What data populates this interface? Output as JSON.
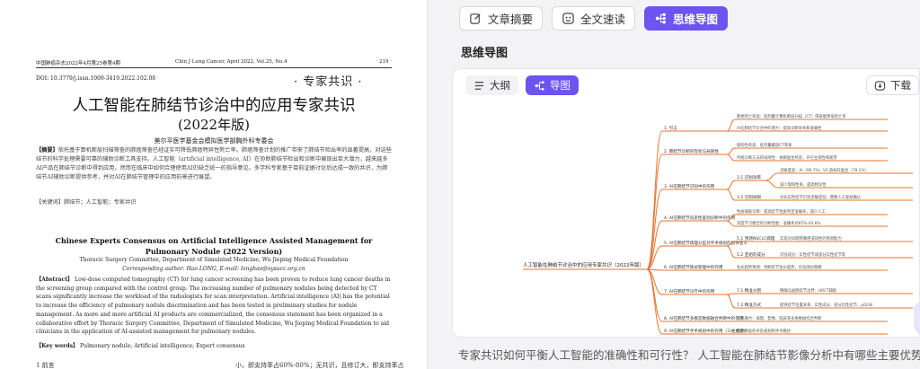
{
  "document": {
    "header_left": "中国肺癌杂志2022年4月第25卷第4期",
    "header_center": "Chin J Lung Cancer, April 2022, Vol.25, No.4",
    "header_right": "· 219 ·",
    "doi": "DOI: 10.3779/j.issn.1009-3419.2022.102.08",
    "stamp": "· 专家共识 ·",
    "title": "人工智能在肺结节诊治中的应用专家共识",
    "title_edition": "(2022年版)",
    "organization": "美尔平医学基金会模拟医学部胸外科专委会",
    "cn_abstract_label": "【摘要】",
    "cn_abstract": "依托基于算机断层扫描筛查的肺癌筛查已经证实可降低肺癌特异性死亡率。肺癌筛查计划的推广带来了肺结节检出率的显著提高，对这些结节的科学处理需要可靠的辅助诊断工具支持。人工智能（artificial intelligence, AI）在协助肺结节检出和诊断中展现出巨大潜力，越来越多AI产品在肺结节诊断中得到应用，然而在临床中如何合理使用AI仍缺乏统一的指导意见。多学科专家基于目前证据讨论后达成一致的共识，为肺结节AI辅助诊断提供参考，并对AI在肺结节管理中的应用前景进行展望。",
    "cn_keywords_label": "【关键词】",
    "cn_keywords": "肺结节；人工智能；专家共识",
    "en_title": "Chinese Experts Consensus on Artificial Intelligence Assisted Management for Pulmonary Nodule (2022 Version)",
    "en_affiliation": "Thoracic Surgery Committee, Department of Simulated Medicine, Wu Jieping Medical Foundation",
    "en_corresponding": "Corresponding author: Hao LONG, E-mail: longhao@sysucc.org.cn",
    "en_abstract_label": "【Abstract】",
    "en_abstract": "Low-dose computed tomography (CT) for lung cancer screening has been proven to reduce lung cancer deaths in the screening group compared with the control group. The increasing number of pulmonary nodules being detected by CT scans significantly increase the workload of the radiologists for scan interpretation. Artificial intelligence (AI) has the potential to increase the efficiency of pulmonary nodule discrimination and has been tested in preliminary studies for nodule management. As more and more artificial AI products are commercialized, the consensus statement has been organized in a collaborative effort by Thoracic Surgery Committee, Department of Simulated Medicine, Wu Jieping Medical Foundation to aid clinicians in the application of AI-assisted management for pulmonary nodules.",
    "en_keywords_label": "【Key words】",
    "en_keywords": "Pulmonary nodule; Artificial intelligence; Expert consensus",
    "footer_left": "1 前言",
    "footer_right": "小，即支持率占60%-80%；无共识，且修订大，即支持率占"
  },
  "panel": {
    "tabs": [
      {
        "label": "文章摘要",
        "icon": "edit-icon"
      },
      {
        "label": "全文速读",
        "icon": "reader-icon"
      },
      {
        "label": "思维导图",
        "icon": "mindmap-icon"
      }
    ],
    "section_title": "思维导图",
    "view_options": [
      {
        "label": "大纲",
        "icon": "outline-icon"
      },
      {
        "label": "导图",
        "icon": "mindmap-icon"
      }
    ],
    "download_label": "下载",
    "download2_label": "下",
    "question": "专家共识如何平衡人工智能的准确性和可行性？ 人工智能在肺结节影像分析中有哪些主要优势？",
    "accent_color": "#6b54ef",
    "branch_color": "#e8732e"
  },
  "mindmap": {
    "root": "人工智能在肺结节诊治中的应用专家共识（2022年版）",
    "branches": [
      {
        "label": "1. 引言",
        "children": [
          {
            "label": "肺癌死亡率高：低剂量计算机断层扫描（CT）筛查能降低死亡率"
          },
          {
            "label": "AI在肺结节诊治中的潜力：提高诊断效率和准确性"
          }
        ]
      },
      {
        "label": "2. 肺结节诊断的现状与局限性",
        "children": [
          {
            "label": "假阳性率高：低剂量螺旋CT筛查"
          },
          {
            "label": "传统诊断方法的局限性：依赖医生经验，存在主观性和疲劳"
          }
        ]
      },
      {
        "label": "3. AI在肺结节识别中的作用",
        "children": [
          {
            "label": "3.1 识别效率",
            "children": [
              {
                "label": "灵敏度高：AI（96.7%）VS 放射科医生（78.1%）"
              },
              {
                "label": "减少假阳性率，提高特异性"
              }
            ]
          },
          {
            "label": "3.2 识别局限",
            "children": [
              {
                "label": "对非实性结节识别灵敏度低：需要人工复核确认"
              }
            ]
          }
        ]
      },
      {
        "label": "4. AI在肺结节良恶性鉴别诊断中的作用",
        "children": [
          {
            "label": "性质辅助诊断：提高结节性质判定准确率，减少人工"
          },
          {
            "label": "深度学习模型的诊断性能：准确率达85%-93.6%"
          }
        ]
      },
      {
        "label": "5. AI在肺结节病理分型对手术规划的指导意义",
        "children": [
          {
            "label": "5.1 预测NSCLC病理",
            "children": [
              {
                "label": "实现对早期肺腺癌浸润性的预测能力"
              }
            ]
          },
          {
            "label": "5.2 亚组的成分",
            "children": [
              {
                "label": "识别成分：实性结节或部分实性结节等"
              }
            ]
          }
        ]
      },
      {
        "label": "6. AI在肺结节随访管理中的作用",
        "children": [
          {
            "label": "生长趋势预测：判断结节生长趋势，优化随访策略"
          }
        ]
      },
      {
        "label": "7. AI在肺结节诊疗中的作用",
        "children": [
          {
            "label": "7.1 精准分割",
            "children": [
              {
                "label": "精确勾画肺结节边界：HRCT辅助"
              }
            ]
          },
          {
            "label": "7.2 精准方式",
            "children": [
              {
                "label": "提供结节位置关系、实性成分、部分实性结节、pGGN"
              }
            ]
          }
        ]
      },
      {
        "label": "8. AI在肺结节多模态数据融合判断中的作用",
        "children": [
          {
            "label": "信息融合：病理、影像、临床等多维数据综合判断"
          }
        ]
      },
      {
        "label": "9. AI在肺结节手术规划中的作用（三维重建）",
        "children": [
          {
            "label": "提供精准的术前规划和手术路径"
          }
        ]
      }
    ]
  }
}
